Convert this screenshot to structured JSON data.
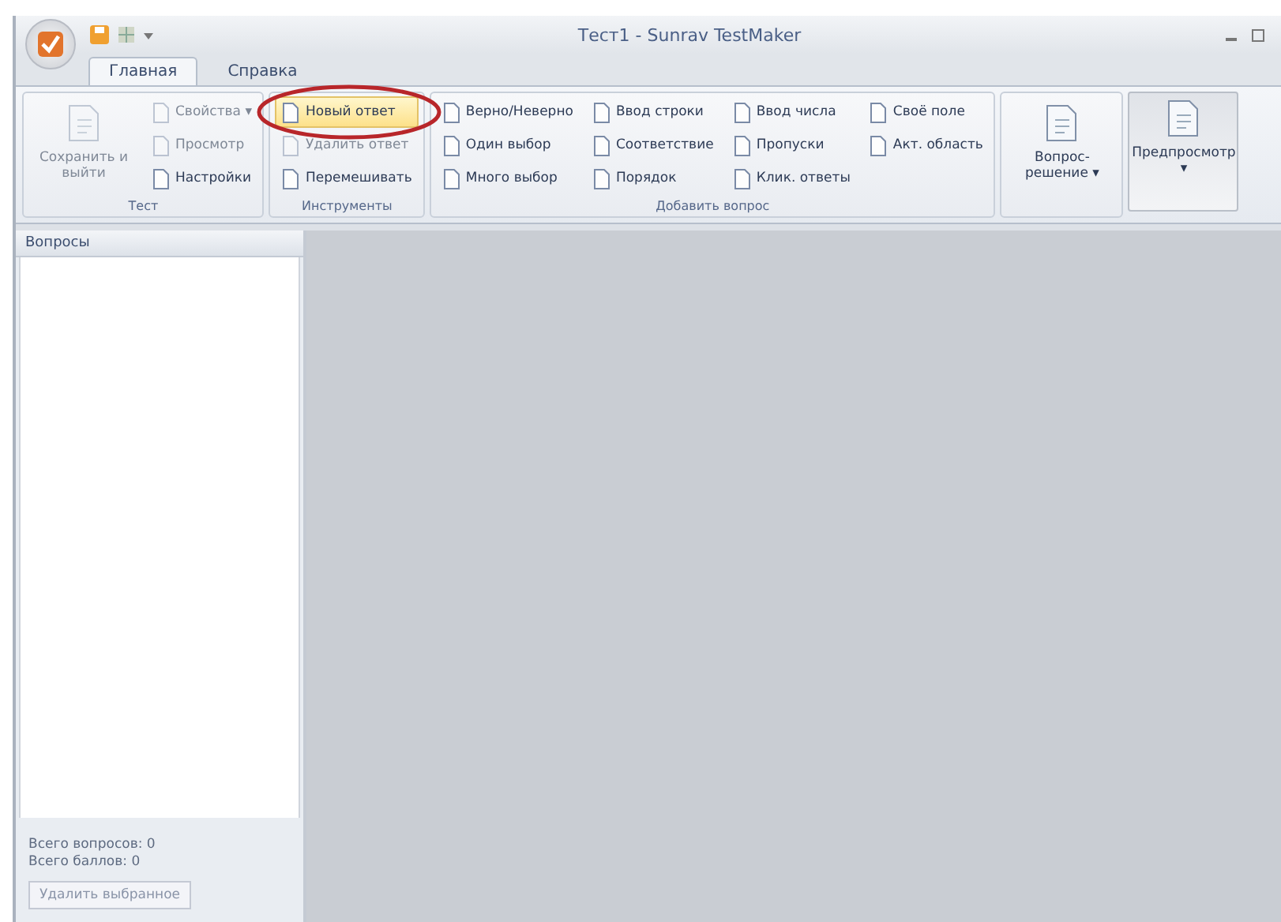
{
  "window": {
    "title": "Тест1 - Sunrav TestMaker"
  },
  "tabs": [
    {
      "label": "Главная",
      "selected": true
    },
    {
      "label": "Справка",
      "selected": false
    }
  ],
  "ribbon_groups": [
    {
      "label": "Тест",
      "buttons": [
        {
          "kind": "large",
          "label": "Сохранить и выйти",
          "disabled": true,
          "pressed": false,
          "highlighted": false
        },
        {
          "kind": "small",
          "label": "Свойства ▾",
          "disabled": true,
          "pressed": false,
          "highlighted": false
        },
        {
          "kind": "small",
          "label": "Просмотр",
          "disabled": true,
          "pressed": false,
          "highlighted": false
        },
        {
          "kind": "small",
          "label": "Настройки",
          "disabled": false,
          "pressed": false,
          "highlighted": false
        }
      ]
    },
    {
      "label": "Инструменты",
      "buttons": [
        {
          "kind": "small",
          "label": "Новый ответ",
          "disabled": false,
          "pressed": false,
          "highlighted": true
        },
        {
          "kind": "small",
          "label": "Удалить ответ",
          "disabled": true,
          "pressed": false,
          "highlighted": false
        },
        {
          "kind": "small",
          "label": "Перемешивать",
          "disabled": false,
          "pressed": false,
          "highlighted": false
        }
      ]
    },
    {
      "label": "Добавить вопрос",
      "buttons": [
        {
          "kind": "small",
          "label": "Верно/Неверно",
          "disabled": false,
          "pressed": false,
          "highlighted": false
        },
        {
          "kind": "small",
          "label": "Один выбор",
          "disabled": false,
          "pressed": false,
          "highlighted": false
        },
        {
          "kind": "small",
          "label": "Много выбор",
          "disabled": false,
          "pressed": false,
          "highlighted": false
        },
        {
          "kind": "small",
          "label": "Ввод строки",
          "disabled": false,
          "pressed": false,
          "highlighted": false
        },
        {
          "kind": "small",
          "label": "Соответствие",
          "disabled": false,
          "pressed": false,
          "highlighted": false
        },
        {
          "kind": "small",
          "label": "Порядок",
          "disabled": false,
          "pressed": false,
          "highlighted": false
        },
        {
          "kind": "small",
          "label": "Ввод числа",
          "disabled": false,
          "pressed": false,
          "highlighted": false
        },
        {
          "kind": "small",
          "label": "Пропуски",
          "disabled": false,
          "pressed": false,
          "highlighted": false
        },
        {
          "kind": "small",
          "label": "Клик. ответы",
          "disabled": false,
          "pressed": false,
          "highlighted": false
        },
        {
          "kind": "small",
          "label": "Своё поле",
          "disabled": false,
          "pressed": false,
          "highlighted": false
        },
        {
          "kind": "small",
          "label": "Акт. область",
          "disabled": false,
          "pressed": false,
          "highlighted": false
        }
      ]
    },
    {
      "buttons": [
        {
          "kind": "large",
          "label": "Вопрос-решение ▾",
          "disabled": false,
          "pressed": false,
          "highlighted": false
        }
      ]
    },
    {
      "buttons": [
        {
          "kind": "large",
          "label": "Предпросмотр ▾",
          "disabled": false,
          "pressed": true,
          "highlighted": false
        }
      ]
    }
  ],
  "sidebar": {
    "title": "Вопросы",
    "stats": [
      "Всего вопросов: 0",
      "Всего баллов: 0"
    ],
    "button": "Удалить выбранное"
  }
}
